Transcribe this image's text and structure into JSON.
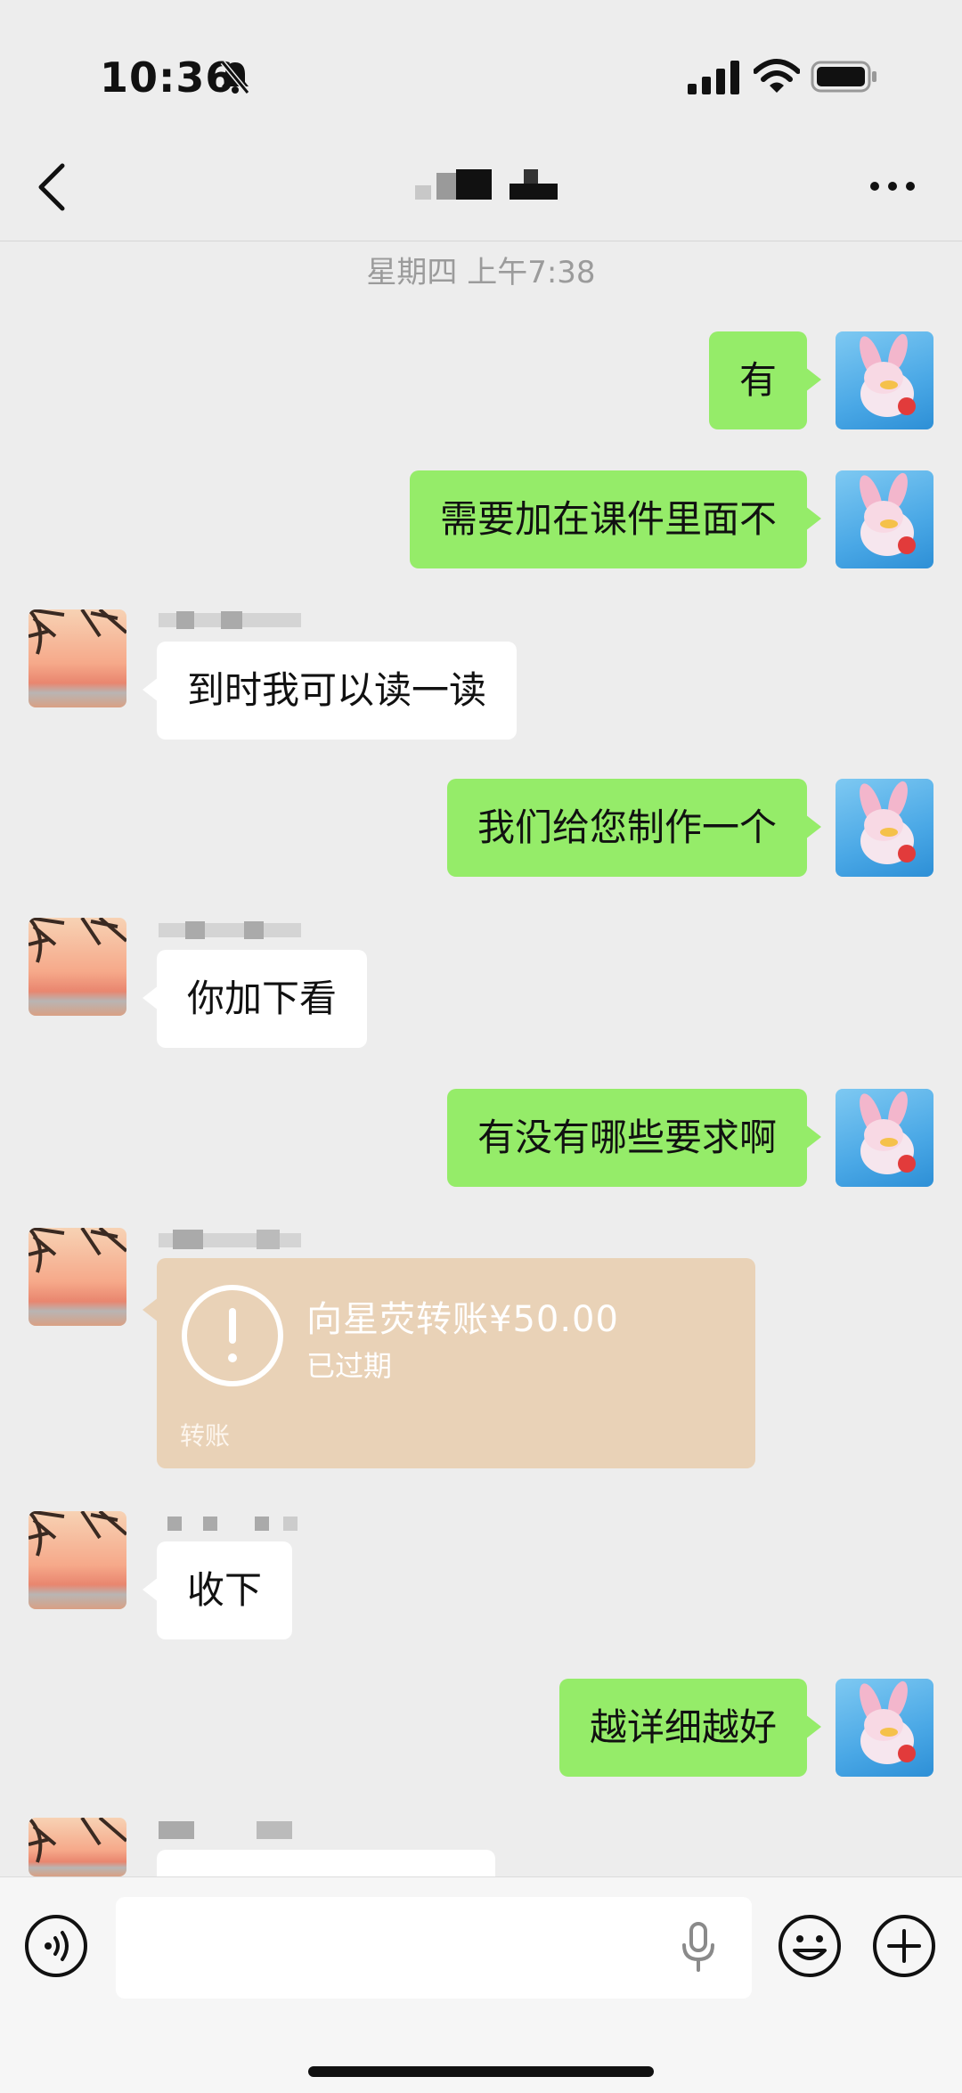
{
  "status_bar": {
    "time": "10:36"
  },
  "chat": {
    "timestamp": "星期四 上午7:38"
  },
  "messages": [
    {
      "side": "me",
      "text": "有"
    },
    {
      "side": "me",
      "text": "需要加在课件里面不"
    },
    {
      "side": "other",
      "text": "到时我可以读一读"
    },
    {
      "side": "me",
      "text": "我们给您制作一个"
    },
    {
      "side": "other",
      "text": "你加下看"
    },
    {
      "side": "me",
      "text": "有没有哪些要求啊"
    },
    {
      "side": "other",
      "type": "transfer",
      "title": "向星荧转账¥50.00",
      "status": "已过期",
      "label": "转账"
    },
    {
      "side": "other",
      "text": "收下"
    },
    {
      "side": "me",
      "text": "越详细越好"
    }
  ],
  "colors": {
    "my_bubble": "#95ec69",
    "other_bubble": "#ffffff",
    "transfer_card": "#e9d2b7",
    "background": "#ededed"
  },
  "icons": [
    "bell-muted-icon",
    "signal-icon",
    "wifi-icon",
    "battery-icon",
    "back-icon",
    "more-icon",
    "voice-icon",
    "mic-icon",
    "emoji-icon",
    "plus-icon",
    "alert-icon"
  ]
}
